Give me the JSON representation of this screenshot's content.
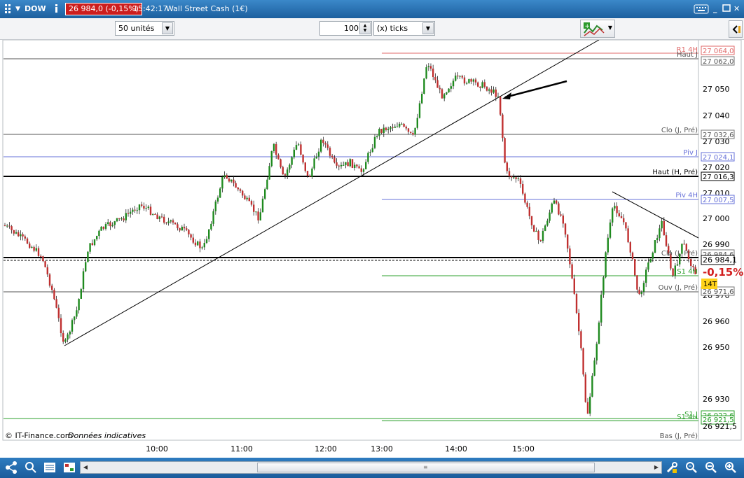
{
  "titlebar": {
    "symbol": "DOW",
    "info_icon": "info-icon",
    "price_badge": "26 984,0 (-0,15%)",
    "time": "15:42:17",
    "instrument": "Wall Street Cash (1€)"
  },
  "toolbar": {
    "units_value": "50 unités",
    "ticks_number": "100",
    "ticks_unit": "(x) ticks"
  },
  "chart": {
    "colors": {
      "up": "#1f8a1f",
      "down": "#c03030",
      "pivot_blue": "#6670d8",
      "r1_red": "#e06a6a",
      "support_green": "#2ca02c"
    },
    "y_axis_ticks": [
      "27 050",
      "27 040",
      "27 030",
      "27 020",
      "27 010",
      "27 000",
      "26 990",
      "26 970",
      "26 960",
      "26 950",
      "26 930"
    ],
    "x_axis_ticks": [
      "10:00",
      "11:00",
      "12:00",
      "13:00",
      "14:00",
      "15:00"
    ],
    "level_labels": {
      "r1": "R1 4H",
      "haut_j": "Haut J",
      "clo": "Clo (J, Pré)",
      "piv_j": "Piv J",
      "haut_h": "Haut (H, Pré)",
      "piv_4h": "Piv 4H",
      "clo2": "Clo (J, Pré)",
      "s1": "S1 4H",
      "ouv": "Ouv (J, Pré)",
      "s1j": "S1 J",
      "s14h": "S1 4H",
      "bas": "Bas (J, Pré)"
    },
    "level_values": {
      "r1": "27 064,0",
      "haut_j": "27 062,0",
      "clo": "27 032,6",
      "piv_j": "27 024,1",
      "haut_h": "27 016,3",
      "piv_4h": "27 007,5",
      "clo2": "26 984,6",
      "last": "26 984,1",
      "ouv": "26 971,6",
      "s1j": "26 922,6",
      "s14h": "26 921,5",
      "bas": "26 921,5"
    },
    "change_pct": "-0,15%",
    "timeframe_badge": "14T",
    "footer_source": "© IT-Finance.com",
    "footer_note": "Données indicatives"
  },
  "bottombar": {
    "icons": [
      "share-icon",
      "mode-icon",
      "list-icon",
      "indicator-icon",
      "tools-icon",
      "zoom-fit-icon",
      "zoom-out-icon",
      "zoom-in-icon"
    ]
  }
}
